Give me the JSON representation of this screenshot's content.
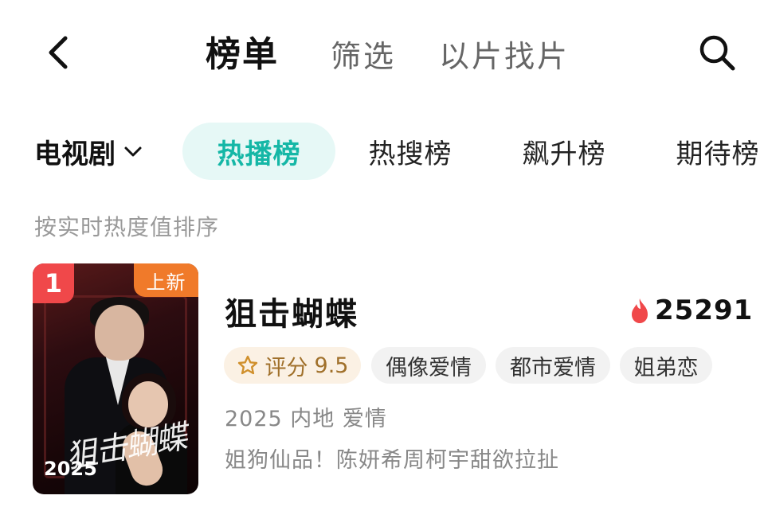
{
  "header": {
    "tabs": [
      {
        "label": "榜单",
        "active": true
      },
      {
        "label": "筛选",
        "active": false
      },
      {
        "label": "以片找片",
        "active": false
      }
    ],
    "back_icon": "chevron-left-icon",
    "search_icon": "search-icon"
  },
  "filters": {
    "category": "电视剧",
    "chart_tabs": [
      {
        "label": "热播榜",
        "active": true
      },
      {
        "label": "热搜榜",
        "active": false
      },
      {
        "label": "飙升榜",
        "active": false
      },
      {
        "label": "期待榜",
        "active": false
      }
    ],
    "sort_note": "按实时热度值排序"
  },
  "colors": {
    "accent": "#15b7a6",
    "rank_badge": "#f0484a",
    "new_badge": "#f07a2a",
    "heat_flame": "#f0484a",
    "rating_text": "#a0702a"
  },
  "items": [
    {
      "rank": "1",
      "badge": "上新",
      "poster_title": "狙击蝴蝶",
      "poster_year": "2025",
      "title": "狙击蝴蝶",
      "heat": "25291",
      "rating_label": "评分",
      "rating_value": "9.5",
      "tags": [
        "偶像爱情",
        "都市爱情",
        "姐弟恋"
      ],
      "meta": "2025 内地 爱情",
      "description": "姐狗仙品！陈妍希周柯宇甜欲拉扯"
    }
  ]
}
